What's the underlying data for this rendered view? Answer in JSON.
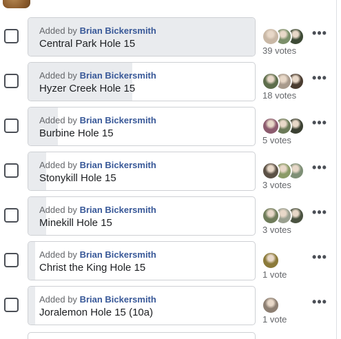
{
  "added_prefix": "Added by",
  "more_icon": "more-horizontal-icon",
  "options": [
    {
      "added_by": "Brian Bickersmith",
      "title": "Central Park Hole 15",
      "votes_label": "39 votes",
      "vote_share": 1.0,
      "voter_count_shown": 3,
      "avatar_colors": [
        "#c9b8a6",
        "#7b8f6a",
        "#3d4a35"
      ]
    },
    {
      "added_by": "Brian Bickersmith",
      "title": "Hyzer Creek Hole 15",
      "votes_label": "18 votes",
      "vote_share": 0.46,
      "voter_count_shown": 3,
      "avatar_colors": [
        "#5e6e4c",
        "#a89a8c",
        "#4a3c30"
      ]
    },
    {
      "added_by": "Brian Bickersmith",
      "title": "Burbine Hole 15",
      "votes_label": "5 votes",
      "vote_share": 0.13,
      "voter_count_shown": 3,
      "avatar_colors": [
        "#8c5b6e",
        "#6b7a58",
        "#3b4032"
      ]
    },
    {
      "added_by": "Brian Bickersmith",
      "title": "Stonykill Hole 15",
      "votes_label": "3 votes",
      "vote_share": 0.08,
      "voter_count_shown": 3,
      "avatar_colors": [
        "#5b5145",
        "#8b9b67",
        "#7e8f76"
      ]
    },
    {
      "added_by": "Brian Bickersmith",
      "title": "Minekill Hole 15",
      "votes_label": "3 votes",
      "vote_share": 0.08,
      "voter_count_shown": 3,
      "avatar_colors": [
        "#6f7c5a",
        "#9aa090",
        "#4a5240"
      ]
    },
    {
      "added_by": "Brian Bickersmith",
      "title": "Christ the King Hole 15",
      "votes_label": "1 vote",
      "vote_share": 0.03,
      "voter_count_shown": 1,
      "avatar_colors": [
        "#8b7a3a"
      ]
    },
    {
      "added_by": "Brian Bickersmith",
      "title": "Joralemon Hole 15 (10a)",
      "votes_label": "1 vote",
      "vote_share": 0.03,
      "voter_count_shown": 1,
      "avatar_colors": [
        "#8d7f72"
      ]
    }
  ]
}
